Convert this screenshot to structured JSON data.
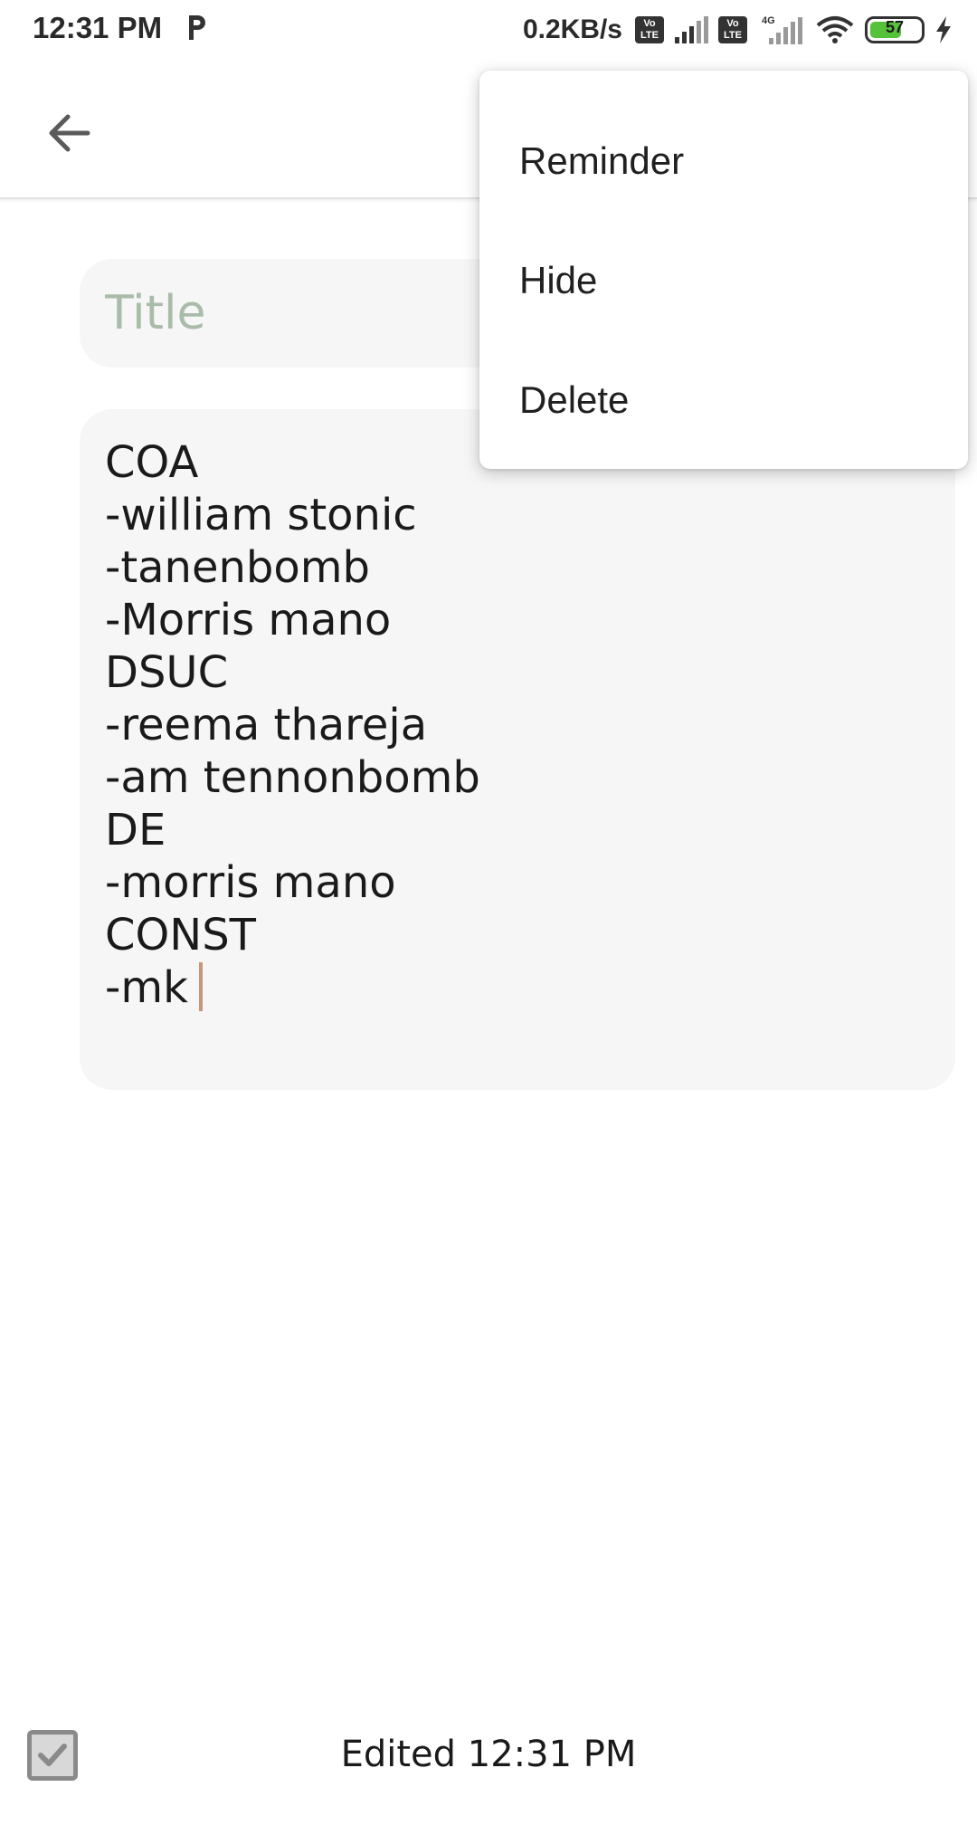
{
  "status_bar": {
    "time": "12:31 PM",
    "speed": "0.2KB/s",
    "volte_label": "Vo LTE",
    "network": "4G",
    "battery": "57"
  },
  "icons": {
    "back": "arrow-left",
    "checklist": "checkbox-checked"
  },
  "note": {
    "title_placeholder": "Title",
    "title_value": "",
    "lines": [
      "COA",
      "-william stonic",
      "-tanenbomb",
      "-Morris mano",
      "DSUC",
      "-reema thareja",
      "-am tennonbomb",
      "DE",
      "-morris mano",
      "CONST",
      "-mk"
    ]
  },
  "menu": {
    "items": [
      "Reminder",
      "Hide",
      "Delete"
    ]
  },
  "footer": {
    "edited_text": "Edited  12:31 PM"
  },
  "colors": {
    "title_placeholder": "#a9bca9",
    "caret": "#c8957a",
    "card_bg": "#f6f6f6",
    "battery_fill": "#55c23a"
  }
}
